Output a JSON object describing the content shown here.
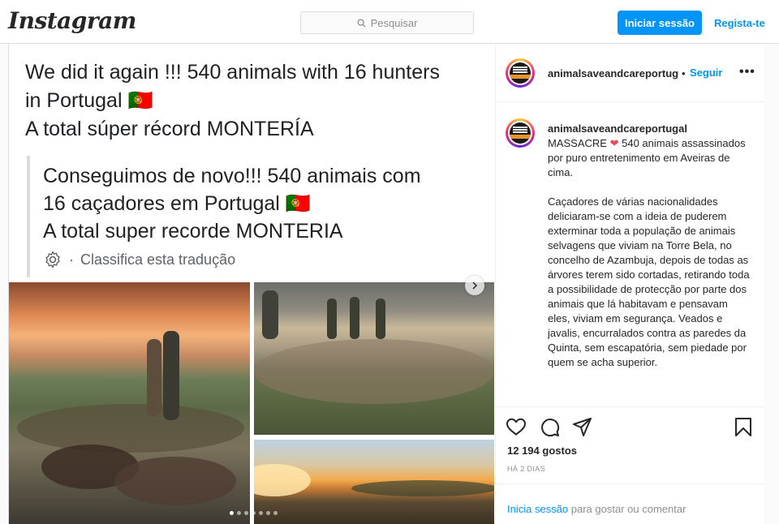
{
  "header": {
    "logo": "Instagram",
    "search_placeholder": "Pesquisar",
    "login_button": "Iniciar sessão",
    "register_link": "Regista-te"
  },
  "media": {
    "original_text": "We did it again !!! 540 animals with 16 hunters in Portugal 🇵🇹 A total súper récord MONTERÍA",
    "original_lines": [
      "We did it again !!! 540 animals with 16 hunters",
      "in Portugal 🇵🇹",
      "A total súper récord MONTERÍA"
    ],
    "translated_lines": [
      "Conseguimos de novo!!! 540 animais com",
      "16 caçadores em Portugal 🇵🇹",
      "A total super recorde MONTERIA"
    ],
    "rate_translation": "Classifica esta tradução",
    "carousel_count": 7,
    "carousel_active_index": 0
  },
  "post": {
    "username": "animalsaveandcareportug",
    "separator": "•",
    "follow": "Seguir",
    "more": "•••",
    "caption_username": "animalsaveandcareportugal",
    "caption_first": "MASSACRE",
    "caption_after_heart": " 540 animais assassinados por puro entretenimento em Aveiras de cima.",
    "caption_para2": "Caçadores de várias nacionalidades deliciaram-se com a ideia de puderem exterminar toda a população de animais selvagens que viviam na Torre Bela, no concelho de Azambuja, depois de todas as árvores terem sido cortadas, retirando toda a possibilidade de protecção por parte dos animais que lá habitavam e pensavam eles, viviam em segurança. Veados e javalis, encurralados contra as paredes da Quinta, sem escapatória, sem piedade por quem se acha superior.",
    "likes": "12 194 gostos",
    "age": "HÁ 2 DIAS",
    "footer_link": "Inicia sessão",
    "footer_text": " para gostar ou comentar"
  },
  "colors": {
    "accent": "#0095f6",
    "heart": "#ed4956",
    "border": "#dbdbdb"
  }
}
